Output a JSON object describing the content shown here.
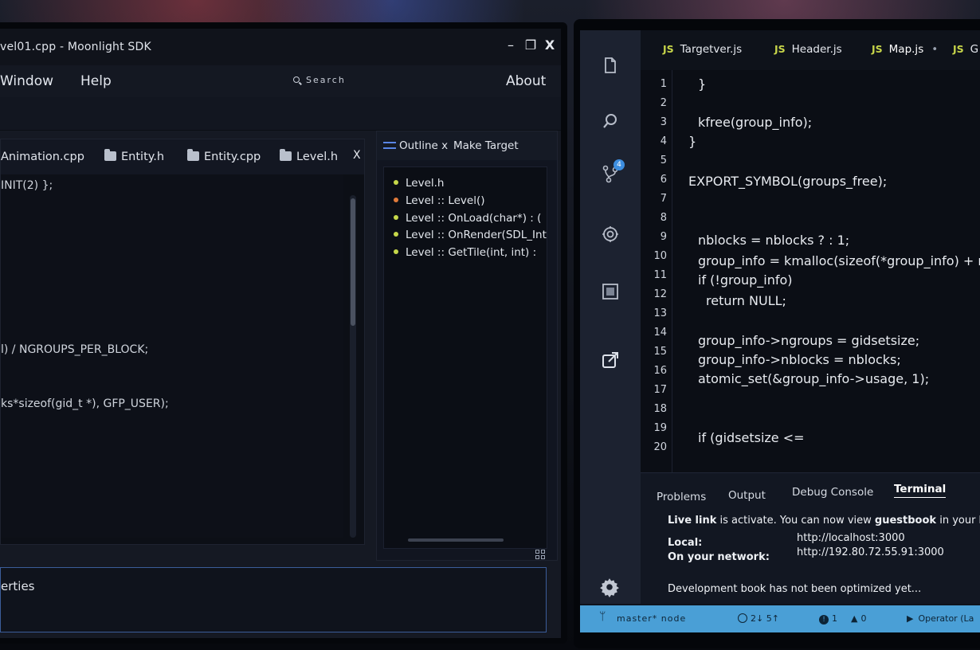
{
  "left_window": {
    "title": "vel01.cpp  -  Moonlight SDK",
    "controls": {
      "minimize": "–",
      "restore": "❐",
      "close": "X"
    },
    "menu": {
      "window": "Window",
      "help": "Help",
      "about": "About"
    },
    "search": {
      "label": "Search"
    },
    "editor_tabs": [
      "Animation.cpp",
      "Entity.h",
      "Entity.cpp",
      "Level.h"
    ],
    "editor_close": "X",
    "code_lines": [
      "INIT(2) };",
      "l) / NGROUPS_PER_BLOCK;",
      "ks*sizeof(gid_t *), GFP_USER);"
    ],
    "outline": {
      "tab_outline": "Outline x",
      "tab_make_target": "Make Target",
      "items": [
        {
          "label": "Level.h",
          "color": "#c6d84a"
        },
        {
          "label": "Level :: Level()",
          "color": "#e07a3a"
        },
        {
          "label": "Level :: OnLoad(char*)   :   (",
          "color": "#c6d84a"
        },
        {
          "label": "Level :: OnRender(SDL_Inte",
          "color": "#c6d84a"
        },
        {
          "label": "Level :: GetTile(int, int)   :",
          "color": "#c6d84a"
        }
      ]
    },
    "properties_label": "erties"
  },
  "right_window": {
    "tabs": [
      {
        "badge": "JS",
        "label": "Targetver.js"
      },
      {
        "badge": "JS",
        "label": "Header.js"
      },
      {
        "badge": "JS",
        "label": "Map.js",
        "active": true,
        "marker": "•"
      },
      {
        "badge": "JS",
        "label": "G"
      }
    ],
    "line_numbers": [
      "1",
      "2",
      "3",
      "4",
      "5",
      "6",
      "7",
      "8",
      "9",
      "10",
      "11",
      "12",
      "13",
      "14",
      "15",
      "16",
      "17",
      "18",
      "19",
      "20"
    ],
    "code": {
      "l1": "}",
      "l3": "kfree(group_info);",
      "l4": "}",
      "l6": "EXPORT_SYMBOL(groups_free);",
      "l9": "nblocks = nblocks ? : 1;",
      "l10": "group_info = kmalloc(sizeof(*group_info) + n",
      "l11": "if (!group_info)",
      "l12": "return NULL;",
      "l14": "group_info->ngroups = gidsetsize;",
      "l15": "group_info->nblocks = nblocks;",
      "l16": "atomic_set(&group_info->usage, 1);",
      "l19": "if (gidsetsize <="
    },
    "panel_tabs": {
      "problems": "Problems",
      "output": "Output",
      "debug": "Debug Console",
      "terminal": "Terminal"
    },
    "terminal": {
      "live_bold": "Live link",
      "live_rest": " is activate. You can now view ",
      "app_bold": "guestbook",
      "live_tail": " in your brow",
      "local_label": "Local:",
      "local_url": "http://localhost:3000",
      "network_label": "On your network:",
      "network_url": "http://192.80.72.55.91:3000",
      "dev_note": "Development book has not been optimized yet..."
    },
    "activity_badge": "4",
    "status": {
      "branch": "master* node",
      "sync": "2↓  5↑",
      "errors": "1",
      "warnings": "0",
      "operator": "Operator (La"
    },
    "colors": {
      "status_bar": "#4a9fd6",
      "js_badge": "#c8d64a",
      "accent": "#5a86e6"
    }
  }
}
